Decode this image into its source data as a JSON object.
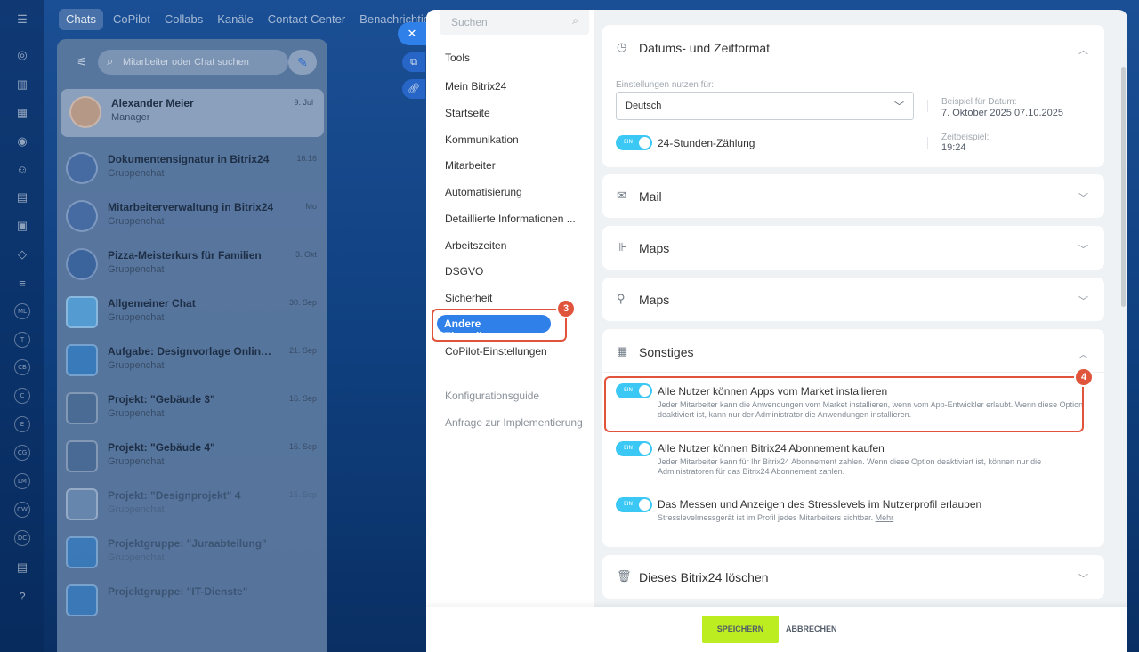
{
  "topnav": [
    "Chats",
    "CoPilot",
    "Collabs",
    "Kanäle",
    "Contact Center",
    "Benachrichtigung"
  ],
  "left_rail_badges": [
    "ML",
    "T",
    "CB",
    "C",
    "E",
    "CG",
    "LM",
    "CW",
    "DC"
  ],
  "chat_panel": {
    "search_placeholder": "Mitarbeiter oder Chat suchen",
    "items": [
      {
        "title": "Alexander Meier",
        "sub": "Manager",
        "date": "9. Jul"
      },
      {
        "title": "Dokumentensignatur in Bitrix24",
        "sub": "Gruppenchat",
        "date": "16:16"
      },
      {
        "title": "Mitarbeiterverwaltung in Bitrix24",
        "sub": "Gruppenchat",
        "date": "Mo"
      },
      {
        "title": "Pizza-Meisterkurs für Familien",
        "sub": "Gruppenchat",
        "date": "3. Okt"
      },
      {
        "title": "Allgemeiner Chat",
        "sub": "Gruppenchat",
        "date": "30. Sep"
      },
      {
        "title": "Aufgabe: Designvorlage Onlinesho...",
        "sub": "Gruppenchat",
        "date": "21. Sep"
      },
      {
        "title": "Projekt: \"Gebäude 3\"",
        "sub": "Gruppenchat",
        "date": "16. Sep"
      },
      {
        "title": "Projekt: \"Gebäude 4\"",
        "sub": "Gruppenchat",
        "date": "16. Sep"
      },
      {
        "title": "Projekt: \"Designprojekt\" 4",
        "sub": "Gruppenchat",
        "date": "15. Sep"
      },
      {
        "title": "Projektgruppe: \"Juraabteilung\"",
        "sub": "Gruppenchat",
        "date": ""
      },
      {
        "title": "Projektgruppe: \"IT-Dienste\"",
        "sub": "",
        "date": ""
      }
    ]
  },
  "settings_nav": {
    "search_placeholder": "Suchen",
    "items": [
      "Tools",
      "Mein Bitrix24",
      "Startseite",
      "Kommunikation",
      "Mitarbeiter",
      "Automatisierung",
      "Detaillierte Informationen ...",
      "Arbeitszeiten",
      "DSGVO",
      "Sicherheit"
    ],
    "active": "Andere Einstellungen",
    "after_active": "CoPilot-Einstellungen",
    "secondary": [
      "Konfigurationsguide",
      "Anfrage zur Implementierung"
    ],
    "annotation_3": "3"
  },
  "sections": {
    "datetime": {
      "title": "Datums- und Zeitformat",
      "use_for_label": "Einstellungen nutzen für:",
      "language_value": "Deutsch",
      "date_example_label": "Beispiel für Datum:",
      "date_example_value": "7. Oktober 2025 07.10.2025",
      "toggle_24h_label": "24-Stunden-Zählung",
      "time_example_label": "Zeitbeispiel:",
      "time_example_value": "19:24"
    },
    "mail": {
      "title": "Mail"
    },
    "maps1": {
      "title": "Maps"
    },
    "maps2": {
      "title": "Maps"
    },
    "misc": {
      "title": "Sonstiges",
      "annotation_4": "4",
      "options": [
        {
          "title": "Alle Nutzer können Apps vom Market installieren",
          "desc": "Jeder Mitarbeiter kann die Anwendungen vom Market installieren, wenn vom App-Entwickler erlaubt. Wenn diese Option deaktiviert ist, kann nur der Administrator die Anwendungen installieren."
        },
        {
          "title": "Alle Nutzer können Bitrix24 Abonnement kaufen",
          "desc": "Jeder Mitarbeiter kann für Ihr Bitrix24 Abonnement zahlen. Wenn diese Option deaktiviert ist, können nur die Administratoren für das Bitrix24 Abonnement zahlen."
        },
        {
          "title": "Das Messen und Anzeigen des Stresslevels im Nutzerprofil erlauben",
          "desc": "Stresslevelmessgerät ist im Profil jedes Mitarbeiters sichtbar.",
          "link": "Mehr"
        }
      ]
    },
    "delete": {
      "title": "Dieses Bitrix24 löschen"
    }
  },
  "toggle_text": "EIN",
  "footer": {
    "save": "SPEICHERN",
    "cancel": "ABBRECHEN"
  },
  "colors": {
    "accent": "#2f80e8",
    "toggle": "#3bc8f5",
    "save": "#bbed21",
    "annotation": "#e0543c"
  }
}
